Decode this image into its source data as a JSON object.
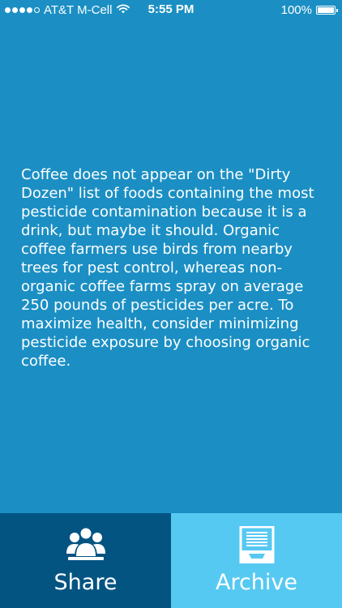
{
  "status_bar": {
    "carrier": "AT&T M-Cell",
    "time": "5:55 PM",
    "battery": "100%",
    "signal_bars_filled": 4,
    "signal_bars_total": 5
  },
  "main": {
    "fact_text": "Coffee does not appear on the \"Dirty Dozen\" list of foods containing the most pesticide contamination because it is a drink, but maybe it should. Organic coffee farmers use birds from nearby trees for pest control, whereas non-organic coffee farms spray on average 250 pounds of pesticides per acre. To maximize health, consider minimizing pesticide exposure by choosing organic coffee."
  },
  "tabbar": {
    "share_label": "Share",
    "archive_label": "Archive",
    "share_icon": "people-icon",
    "archive_icon": "archive-box-icon"
  },
  "colors": {
    "background": "#1b8fc4",
    "share_tab": "#045482",
    "archive_tab": "#56c9f2",
    "text": "#ffffff"
  }
}
